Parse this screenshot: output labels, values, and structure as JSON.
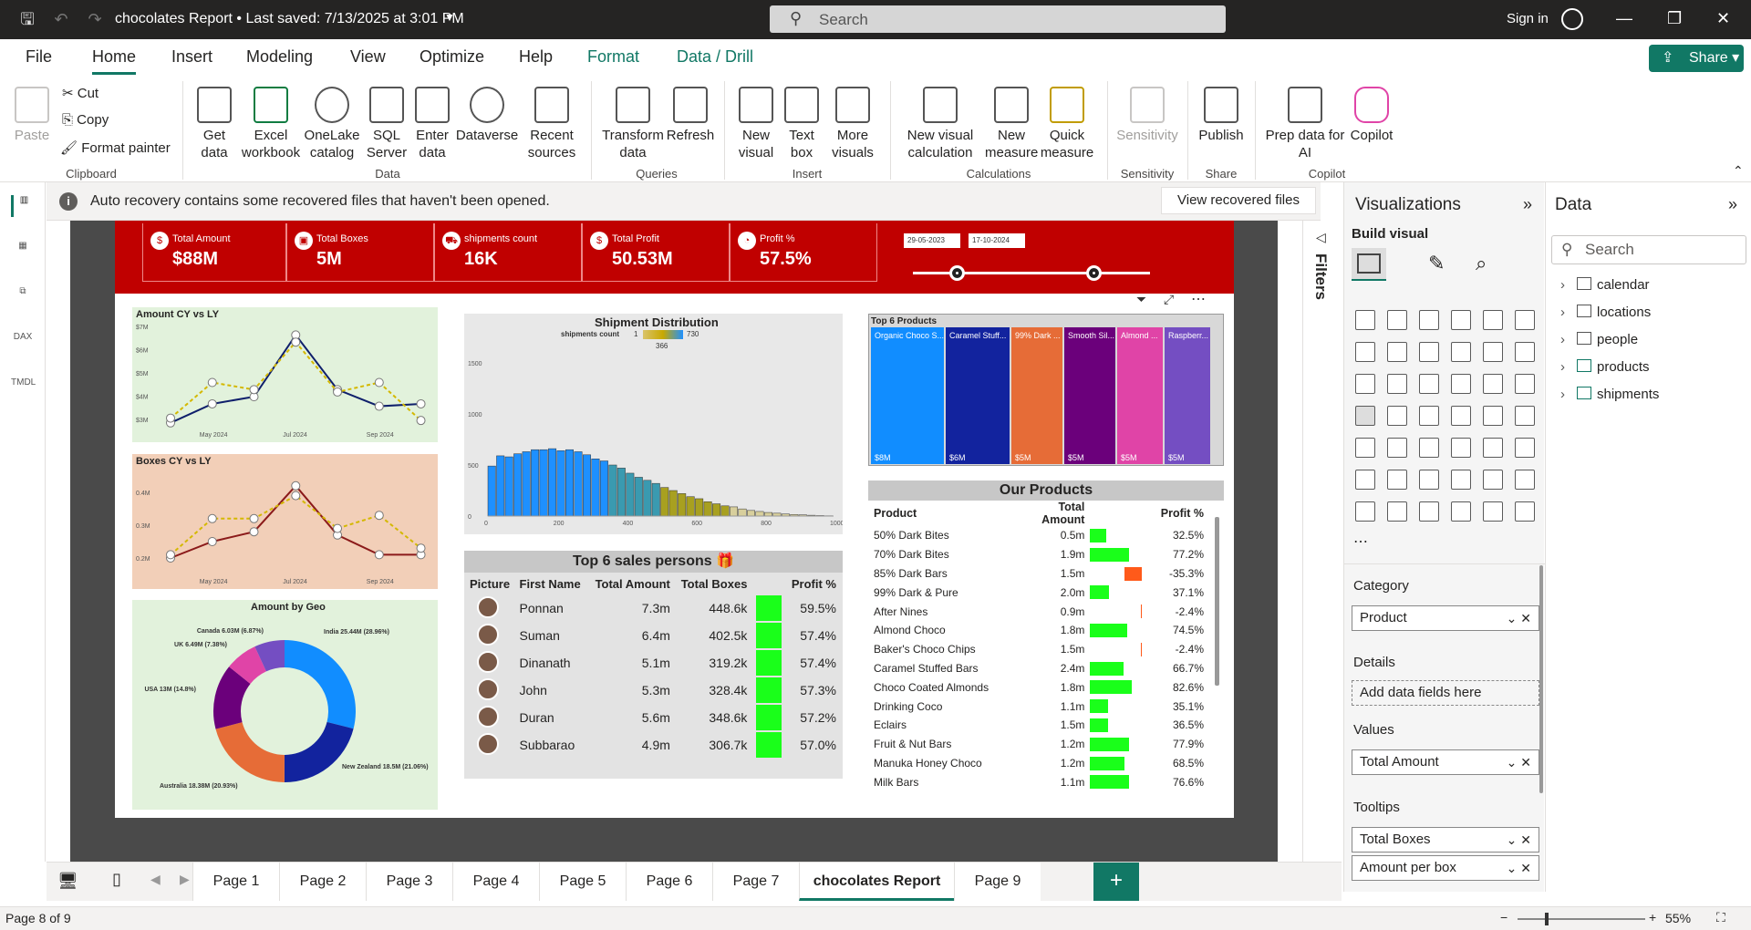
{
  "titlebar": {
    "doc_title": "chocolates Report • Last saved: 7/13/2025 at 3:01 PM",
    "search_placeholder": "Search",
    "signin": "Sign in"
  },
  "menu": {
    "tabs": [
      "File",
      "Home",
      "Insert",
      "Modeling",
      "View",
      "Optimize",
      "Help",
      "Format",
      "Data / Drill"
    ],
    "active": "Home",
    "share": "Share"
  },
  "ribbon": {
    "clipboard": {
      "paste": "Paste",
      "cut": "Cut",
      "copy": "Copy",
      "format_painter": "Format painter",
      "group": "Clipboard"
    },
    "data": {
      "get_data": "Get data",
      "excel": "Excel workbook",
      "onelake": "OneLake catalog",
      "sql": "SQL Server",
      "enter": "Enter data",
      "dataverse": "Dataverse",
      "recent": "Recent sources",
      "group": "Data"
    },
    "queries": {
      "transform": "Transform data",
      "refresh": "Refresh",
      "group": "Queries"
    },
    "insert": {
      "new_visual": "New visual",
      "text_box": "Text box",
      "more_visuals": "More visuals",
      "group": "Insert"
    },
    "calculations": {
      "new_visual_calc": "New visual calculation",
      "new_measure": "New measure",
      "quick_measure": "Quick measure",
      "group": "Calculations"
    },
    "sensitivity": {
      "label": "Sensitivity",
      "group": "Sensitivity"
    },
    "share": {
      "publish": "Publish",
      "group": "Share"
    },
    "copilot": {
      "prep": "Prep data for AI",
      "copilot": "Copilot",
      "group": "Copilot"
    }
  },
  "infobar": {
    "text": "Auto recovery contains some recovered files that haven't been opened.",
    "button": "View recovered files"
  },
  "report": {
    "kpis": [
      {
        "label": "Total Amount",
        "value": "$88M"
      },
      {
        "label": "Total Boxes",
        "value": "5M"
      },
      {
        "label": "shipments count",
        "value": "16K"
      },
      {
        "label": "Total Profit",
        "value": "50.53M"
      },
      {
        "label": "Profit %",
        "value": "57.5%"
      }
    ],
    "date_from": "29-05-2023",
    "date_to": "17-10-2024",
    "amount_chart": {
      "title": "Amount CY vs LY",
      "yticks": [
        "$7M",
        "$6M",
        "$5M",
        "$4M",
        "$3M"
      ],
      "xticks": [
        "May 2024",
        "Jul 2024",
        "Sep 2024"
      ]
    },
    "boxes_chart": {
      "title": "Boxes CY vs LY",
      "yticks": [
        "0.4M",
        "0.3M",
        "0.2M"
      ],
      "xticks": [
        "May 2024",
        "Jul 2024",
        "Sep 2024"
      ]
    },
    "geo_chart": {
      "title": "Amount by Geo",
      "labels": [
        "India 25.44M (28.96%)",
        "New Zealand 18.5M (21.06%)",
        "Australia 18.38M (20.93%)",
        "USA 13M (14.8%)",
        "UK 6.49M (7.38%)",
        "Canada 6.03M (6.87%)"
      ]
    },
    "shipment_chart": {
      "title": "Shipment Distribution",
      "legend_label": "shipments count",
      "legend_min": "1",
      "legend_max": "730",
      "legend_mid": "366",
      "yticks": [
        "1500",
        "1000",
        "500",
        "0"
      ],
      "xticks": [
        "0",
        "200",
        "400",
        "600",
        "800",
        "1000"
      ]
    },
    "sales": {
      "title": "Top 6 sales persons 🎁",
      "headers": [
        "Picture",
        "First Name",
        "Total Amount",
        "Total Boxes",
        "",
        "Profit %"
      ],
      "rows": [
        {
          "name": "Ponnan",
          "amount": "7.3m",
          "boxes": "448.6k",
          "profit": "59.5%"
        },
        {
          "name": "Suman",
          "amount": "6.4m",
          "boxes": "402.5k",
          "profit": "57.4%"
        },
        {
          "name": "Dinanath",
          "amount": "5.1m",
          "boxes": "319.2k",
          "profit": "57.4%"
        },
        {
          "name": "John",
          "amount": "5.3m",
          "boxes": "328.4k",
          "profit": "57.3%"
        },
        {
          "name": "Duran",
          "amount": "5.6m",
          "boxes": "348.6k",
          "profit": "57.2%"
        },
        {
          "name": "Subbarao",
          "amount": "4.9m",
          "boxes": "306.7k",
          "profit": "57.0%"
        }
      ]
    },
    "top6": {
      "title": "Top 6 Products",
      "items": [
        {
          "name": "Organic Choco S...",
          "value": "$8M",
          "color": "#118dff"
        },
        {
          "name": "Caramel Stuff...",
          "value": "$6M",
          "color": "#12239e"
        },
        {
          "name": "99% Dark ...",
          "value": "$5M",
          "color": "#e66c37"
        },
        {
          "name": "Smooth Sil...",
          "value": "$5M",
          "color": "#6b007b"
        },
        {
          "name": "Almond ...",
          "value": "$5M",
          "color": "#e044a7"
        },
        {
          "name": "Raspberr...",
          "value": "$5M",
          "color": "#744ec2"
        }
      ]
    },
    "products": {
      "title": "Our Products",
      "headers": [
        "Product",
        "Total Amount",
        "Profit %"
      ],
      "rows": [
        {
          "name": "50% Dark Bites",
          "amount": "0.5m",
          "profit": "32.5%",
          "p": 32.5
        },
        {
          "name": "70% Dark Bites",
          "amount": "1.9m",
          "profit": "77.2%",
          "p": 77.2
        },
        {
          "name": "85% Dark Bars",
          "amount": "1.5m",
          "profit": "-35.3%",
          "p": -35.3
        },
        {
          "name": "99% Dark & Pure",
          "amount": "2.0m",
          "profit": "37.1%",
          "p": 37.1
        },
        {
          "name": "After Nines",
          "amount": "0.9m",
          "profit": "-2.4%",
          "p": -2.4
        },
        {
          "name": "Almond Choco",
          "amount": "1.8m",
          "profit": "74.5%",
          "p": 74.5
        },
        {
          "name": "Baker's Choco Chips",
          "amount": "1.5m",
          "profit": "-2.4%",
          "p": -2.4
        },
        {
          "name": "Caramel Stuffed Bars",
          "amount": "2.4m",
          "profit": "66.7%",
          "p": 66.7
        },
        {
          "name": "Choco Coated Almonds",
          "amount": "1.8m",
          "profit": "82.6%",
          "p": 82.6
        },
        {
          "name": "Drinking Coco",
          "amount": "1.1m",
          "profit": "35.1%",
          "p": 35.1
        },
        {
          "name": "Eclairs",
          "amount": "1.5m",
          "profit": "36.5%",
          "p": 36.5
        },
        {
          "name": "Fruit & Nut Bars",
          "amount": "1.2m",
          "profit": "77.9%",
          "p": 77.9
        },
        {
          "name": "Manuka Honey Choco",
          "amount": "1.2m",
          "profit": "68.5%",
          "p": 68.5
        },
        {
          "name": "Milk Bars",
          "amount": "1.1m",
          "profit": "76.6%",
          "p": 76.6
        }
      ]
    }
  },
  "filters": {
    "label": "Filters"
  },
  "viz": {
    "title": "Visualizations",
    "build": "Build visual",
    "category_label": "Category",
    "category_field": "Product",
    "details_label": "Details",
    "details_placeholder": "Add data fields here",
    "values_label": "Values",
    "values_field": "Total Amount",
    "tooltips_label": "Tooltips",
    "tooltips_fields": [
      "Total Boxes",
      "Amount per box"
    ]
  },
  "data": {
    "title": "Data",
    "search_placeholder": "Search",
    "tables": [
      "calendar",
      "locations",
      "people",
      "products",
      "shipments"
    ]
  },
  "pages": {
    "tabs": [
      "Page 1",
      "Page 2",
      "Page 3",
      "Page 4",
      "Page 5",
      "Page 6",
      "Page 7",
      "chocolates Report",
      "Page 9"
    ],
    "active": "chocolates Report"
  },
  "status": {
    "page": "Page 8 of 9",
    "zoom": "55%"
  },
  "chart_data": [
    {
      "type": "line",
      "title": "Amount CY vs LY",
      "xlabel": "",
      "ylabel": "",
      "ylim": [
        3,
        7.3
      ],
      "series": [
        {
          "name": "CY",
          "values": [
            3.2,
            4.0,
            4.3,
            6.9,
            4.6,
            3.9,
            4.0
          ]
        },
        {
          "name": "LY",
          "values": [
            3.4,
            4.9,
            4.6,
            6.6,
            4.5,
            4.9,
            3.3
          ]
        }
      ],
      "x": [
        "Apr 2024",
        "May 2024",
        "Jun 2024",
        "Jul 2024",
        "Aug 2024",
        "Sep 2024",
        "Oct 2024"
      ]
    },
    {
      "type": "line",
      "title": "Boxes CY vs LY",
      "xlabel": "",
      "ylabel": "",
      "ylim": [
        0.15,
        0.45
      ],
      "series": [
        {
          "name": "CY",
          "values": [
            0.2,
            0.25,
            0.28,
            0.42,
            0.27,
            0.21,
            0.21
          ]
        },
        {
          "name": "LY",
          "values": [
            0.21,
            0.32,
            0.32,
            0.39,
            0.29,
            0.33,
            0.23
          ]
        }
      ],
      "x": [
        "Apr 2024",
        "May 2024",
        "Jun 2024",
        "Jul 2024",
        "Aug 2024",
        "Sep 2024",
        "Oct 2024"
      ]
    },
    {
      "type": "pie",
      "title": "Amount by Geo",
      "categories": [
        "India",
        "New Zealand",
        "Australia",
        "USA",
        "UK",
        "Canada"
      ],
      "values": [
        25.44,
        18.5,
        18.38,
        13,
        6.49,
        6.03
      ],
      "colors": [
        "#118dff",
        "#12239e",
        "#e66c37",
        "#6b007b",
        "#e044a7",
        "#744ec2"
      ]
    },
    {
      "type": "bar",
      "title": "Shipment Distribution",
      "xlabel": "",
      "ylabel": "",
      "ylim": [
        0,
        1500
      ],
      "values": [
        490,
        590,
        580,
        610,
        630,
        650,
        650,
        660,
        640,
        650,
        630,
        600,
        560,
        540,
        500,
        470,
        420,
        380,
        350,
        320,
        280,
        250,
        220,
        190,
        170,
        140,
        120,
        100,
        90,
        70,
        55,
        45,
        35,
        28,
        20,
        15,
        12,
        8,
        5,
        3
      ],
      "x_range": [
        0,
        1000
      ]
    },
    {
      "type": "bar",
      "title": "Top 6 Products",
      "categories": [
        "Organic Choco S...",
        "Caramel Stuff...",
        "99% Dark ...",
        "Smooth Sil...",
        "Almond ...",
        "Raspberr..."
      ],
      "values": [
        8,
        6,
        5,
        5,
        5,
        5
      ]
    }
  ]
}
